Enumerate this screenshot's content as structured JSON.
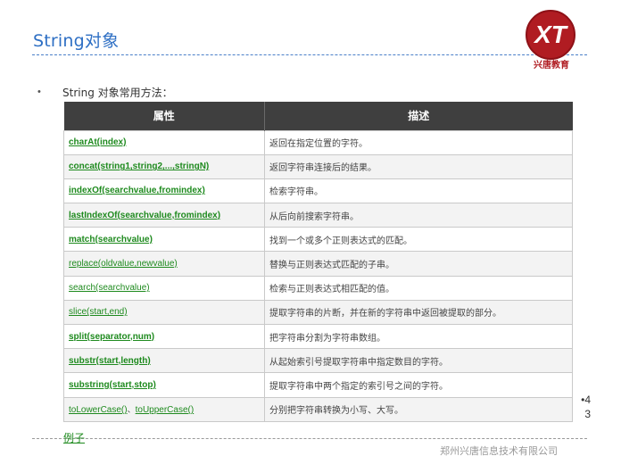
{
  "header": {
    "title": "String对象",
    "logo_mark": "XT",
    "logo_text": "兴唐教育",
    "logo_color": "#b01c22"
  },
  "intro": {
    "bullet": "•",
    "text": "String 对象常用方法："
  },
  "table": {
    "columns": [
      "属性",
      "描述"
    ],
    "rows": [
      {
        "method": "charAt(index)",
        "desc": "返回在指定位置的字符。",
        "bold": true
      },
      {
        "method": "concat(string1,string2,...,stringN)",
        "desc": "返回字符串连接后的结果。",
        "bold": true
      },
      {
        "method": "indexOf(searchvalue,fromindex)",
        "desc": "检索字符串。",
        "bold": true
      },
      {
        "method": "lastIndexOf(searchvalue,fromindex)",
        "desc": "从后向前搜索字符串。",
        "bold": true
      },
      {
        "method": "match(searchvalue)",
        "desc": "找到一个或多个正则表达式的匹配。",
        "bold": true
      },
      {
        "method": "replace(oldvalue,newvalue)",
        "desc": "替换与正则表达式匹配的子串。",
        "bold": false
      },
      {
        "method": "search(searchvalue)",
        "desc": "检索与正则表达式相匹配的值。",
        "bold": false
      },
      {
        "method": "slice(start,end)",
        "desc": "提取字符串的片断，并在新的字符串中返回被提取的部分。",
        "bold": false
      },
      {
        "method": "split(separator,num)",
        "desc": "把字符串分割为字符串数组。",
        "bold": true
      },
      {
        "method": "substr(start,length)",
        "desc": "从起始索引号提取字符串中指定数目的字符。",
        "bold": true
      },
      {
        "method": "substring(start,stop)",
        "desc": "提取字符串中两个指定的索引号之间的字符。",
        "bold": true
      },
      {
        "method_a": "toLowerCase()",
        "method_sep": "、",
        "method_b": "toUpperCase()",
        "desc": "分别把字符串转换为小写、大写。",
        "bold": false
      }
    ]
  },
  "page_number": {
    "line1": "•4",
    "line2": "3"
  },
  "footer": {
    "example_link": "例子",
    "company": "郑州兴唐信息技术有限公司"
  }
}
